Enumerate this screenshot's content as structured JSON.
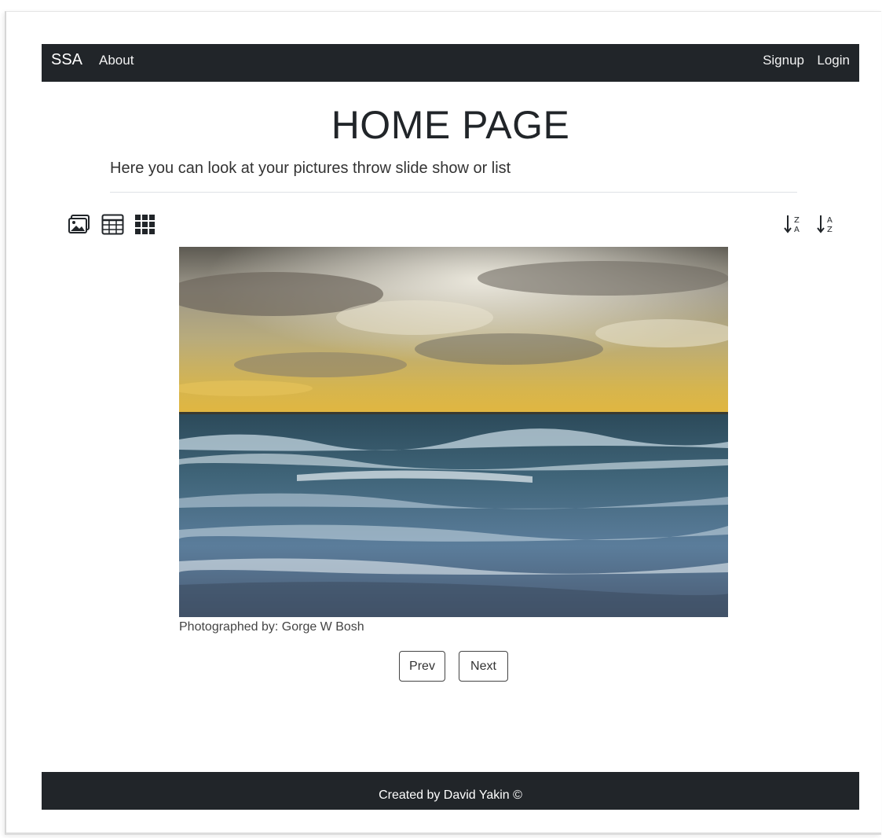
{
  "navbar": {
    "brand": "SSA",
    "about": "About",
    "signup": "Signup",
    "login": "Login"
  },
  "header": {
    "title": "HOME PAGE",
    "subtitle": "Here you can look at your pictures throw slide show or list"
  },
  "toolbar": {
    "view_icons": [
      "image-icon",
      "table-icon",
      "grid-icon"
    ],
    "sort_icons": [
      "sort-z-a-icon",
      "sort-a-z-icon"
    ]
  },
  "slide": {
    "caption": "Photographed by: Gorge W Bosh"
  },
  "controls": {
    "prev_label": "Prev",
    "next_label": "Next"
  },
  "footer": {
    "text": "Created by David Yakin ©"
  },
  "colors": {
    "navbar_bg": "#212529",
    "footer_bg": "#212529"
  }
}
